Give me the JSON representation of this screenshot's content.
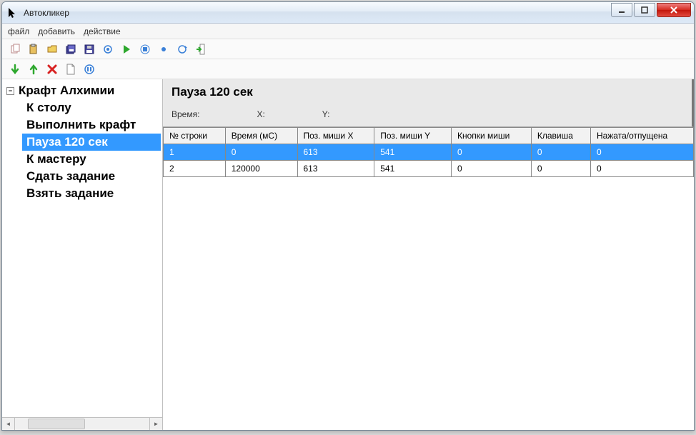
{
  "window": {
    "title": "Автокликер"
  },
  "menu": {
    "file": "файл",
    "add": "добавить",
    "action": "действие"
  },
  "tree": {
    "root": "Крафт Алхимии",
    "items": [
      {
        "label": "К столу",
        "selected": false
      },
      {
        "label": "Выполнить крафт",
        "selected": false
      },
      {
        "label": "Пауза 120 сек",
        "selected": true
      },
      {
        "label": "К мастеру",
        "selected": false
      },
      {
        "label": "Сдать задание",
        "selected": false
      },
      {
        "label": "Взять задание",
        "selected": false
      }
    ]
  },
  "detail": {
    "title": "Пауза 120 сек",
    "meta": {
      "time_label": "Время:",
      "x_label": "X:",
      "y_label": "Y:"
    },
    "columns": [
      "№ строки",
      "Время (мС)",
      "Поз. миши X",
      "Поз. миши Y",
      "Кнопки миши",
      "Клавиша",
      "Нажата/отпущена"
    ],
    "rows": [
      {
        "selected": true,
        "cells": [
          "1",
          "0",
          "613",
          "541",
          "0",
          "0",
          "0"
        ]
      },
      {
        "selected": false,
        "cells": [
          "2",
          "120000",
          "613",
          "541",
          "0",
          "0",
          "0"
        ]
      }
    ]
  }
}
